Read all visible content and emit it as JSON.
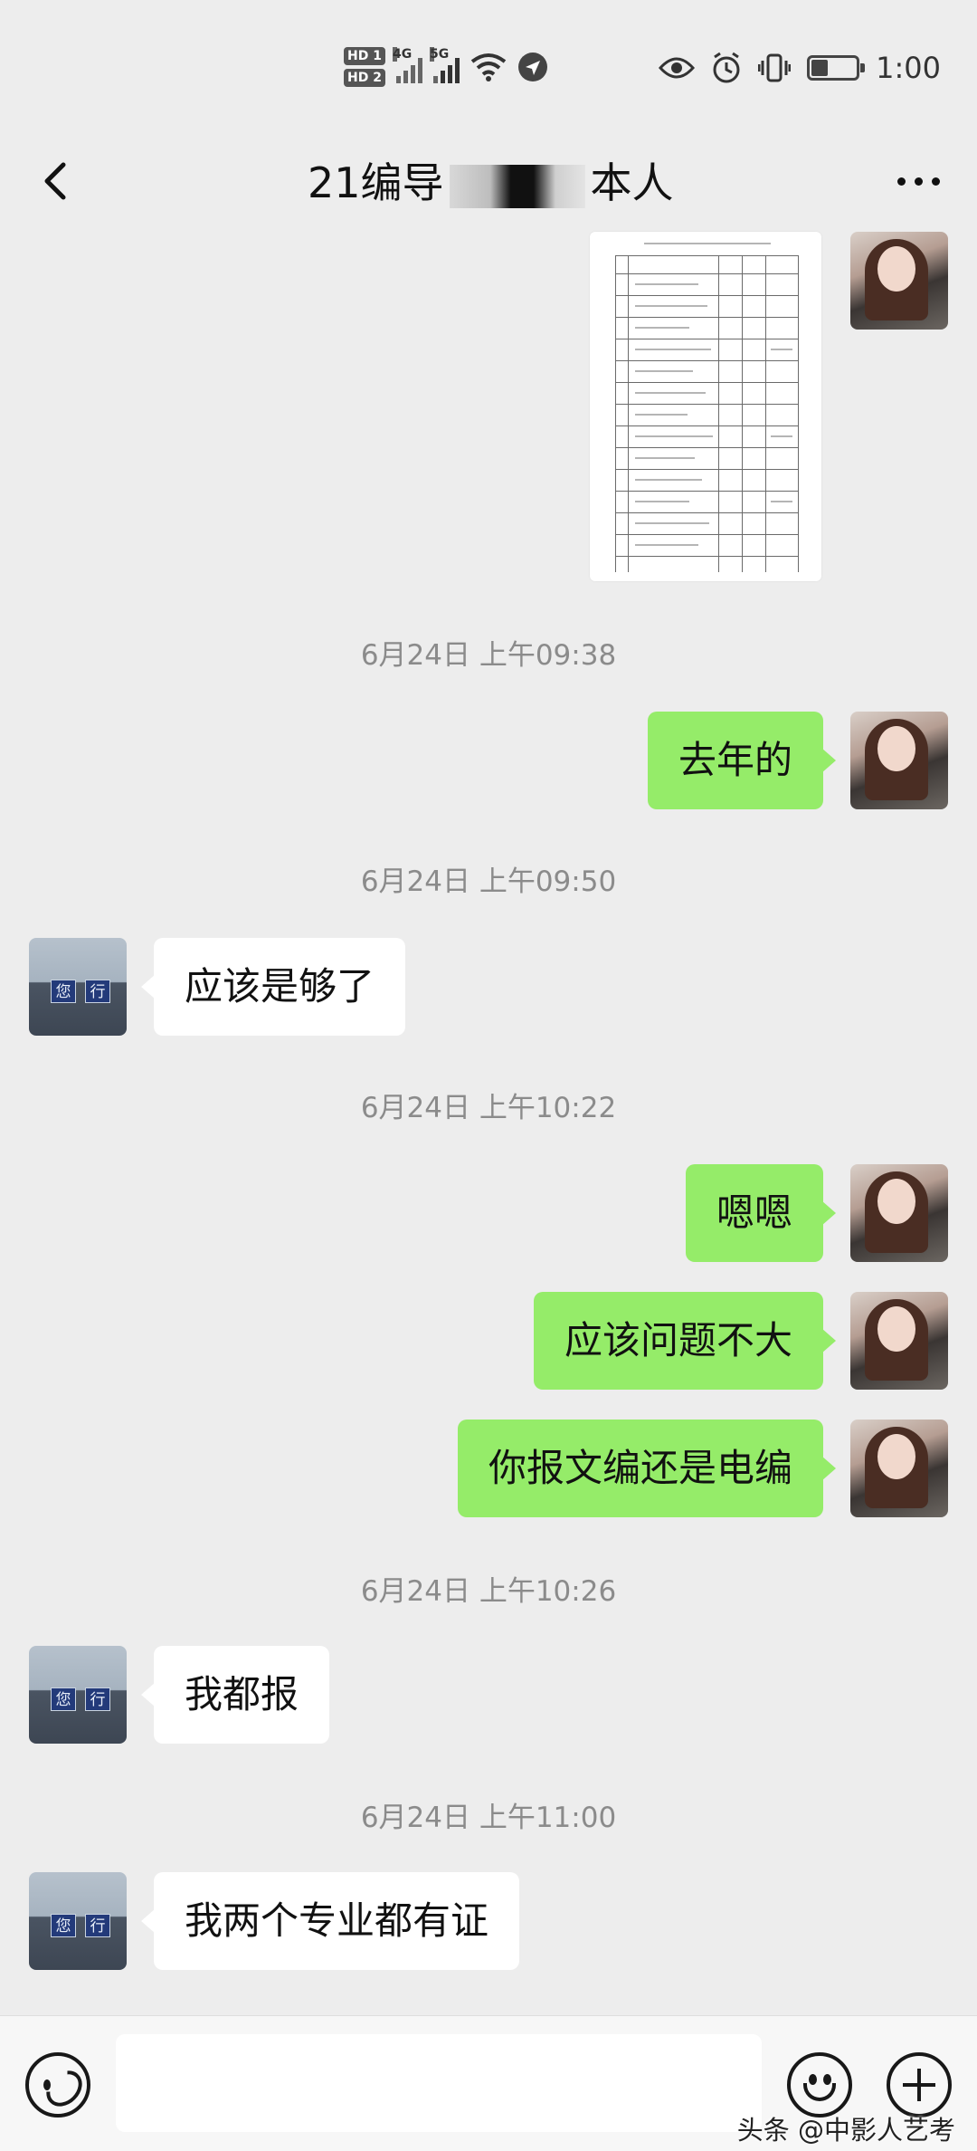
{
  "status_bar": {
    "hd_top": "HD 1",
    "hd_bottom": "HD 2",
    "net_1": "4G",
    "net_2": "5G",
    "time": "1:00"
  },
  "header": {
    "title_prefix": "21编导",
    "title_suffix": "本人"
  },
  "timestamps": {
    "t1": "6月24日 上午09:38",
    "t2": "6月24日 上午09:50",
    "t3": "6月24日 上午10:22",
    "t4": "6月24日 上午10:26",
    "t5": "6月24日 上午11:00"
  },
  "messages": {
    "m1": "去年的",
    "m2": "应该是够了",
    "m3": "嗯嗯",
    "m4": "应该问题不大",
    "m5": "你报文编还是电编",
    "m6": "我都报",
    "m7": "我两个专业都有证"
  },
  "avatar_other_sign": [
    "您",
    "行"
  ],
  "watermark": "头条 @中影人艺考",
  "icons": {
    "back": "back-arrow-icon",
    "more": "more-dots-icon",
    "voice": "voice-icon",
    "emoji": "emoji-icon",
    "plus": "plus-icon"
  },
  "colors": {
    "my_bubble": "#95ec69",
    "their_bubble": "#ffffff",
    "background": "#ededed"
  }
}
